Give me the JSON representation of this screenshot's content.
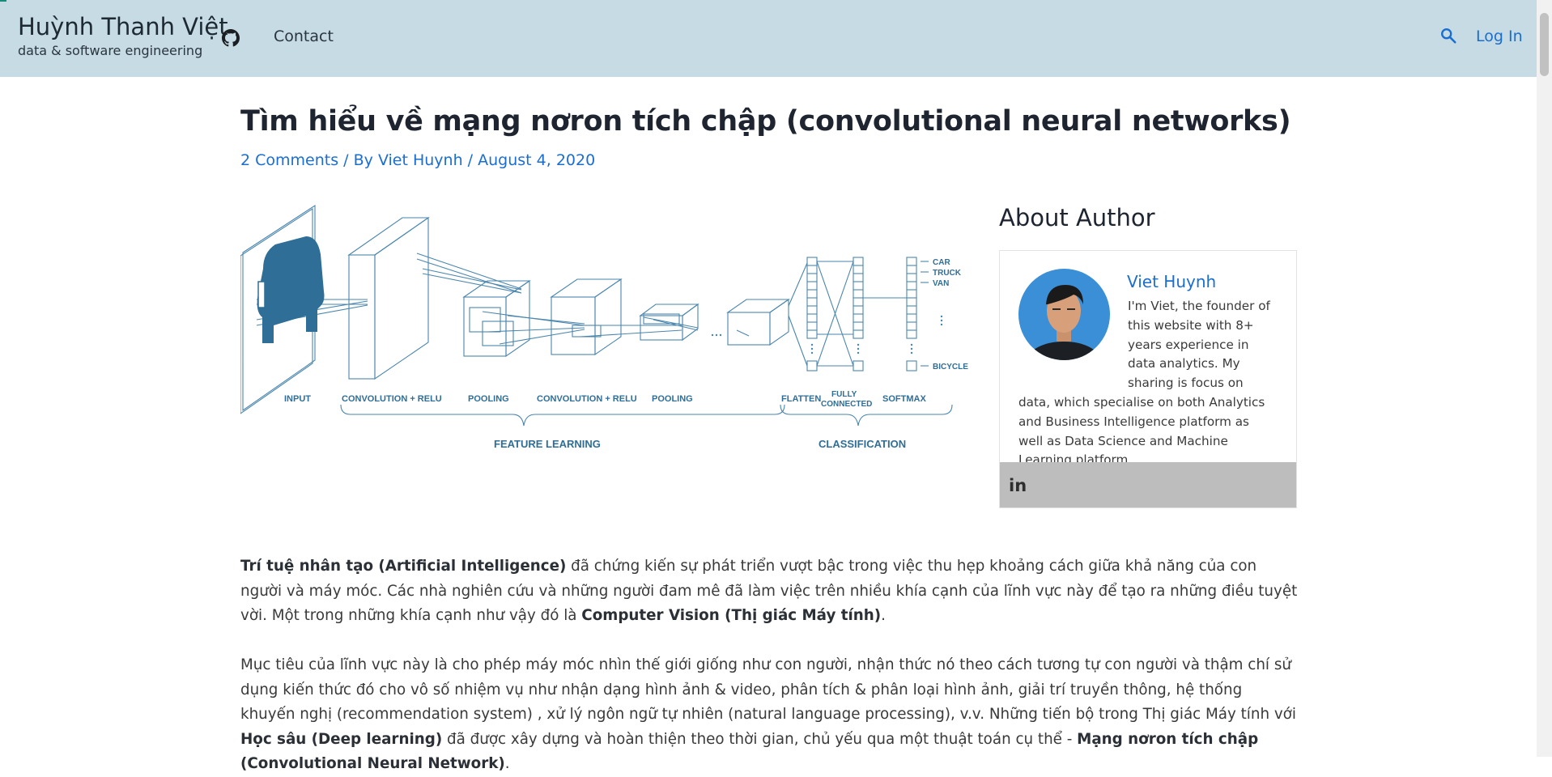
{
  "header": {
    "site_title": "Huỳnh Thanh Việt",
    "tagline": "data & software engineering",
    "nav_contact": "Contact",
    "login": "Log In",
    "icons": [
      "github-icon",
      "search-icon"
    ]
  },
  "article": {
    "title": "Tìm hiểu về mạng nơron tích chập (convolutional neural networks)",
    "meta": {
      "comments": "2 Comments",
      "sep1": " / By ",
      "author": "Viet Huynh",
      "sep2": " / ",
      "date": "August 4, 2020"
    },
    "figure": {
      "stage_labels": [
        "INPUT",
        "CONVOLUTION + RELU",
        "POOLING",
        "CONVOLUTION + RELU",
        "POOLING",
        "FLATTEN",
        "FULLY",
        "CONNECTED",
        "SOFTMAX"
      ],
      "group_labels": [
        "FEATURE LEARNING",
        "CLASSIFICATION"
      ],
      "class_labels": [
        "CAR",
        "TRUCK",
        "VAN",
        "BICYCLE"
      ],
      "colors": {
        "line": "#4a86ad",
        "fill": "#2f6e96"
      }
    },
    "p1": {
      "b1": "Trí tuệ nhân tạo (Artificial Intelligence)",
      "t1": " đã chứng kiến sự phát triển vượt bậc trong việc thu hẹp khoảng cách giữa khả năng của con người và máy móc. Các nhà nghiên cứu và những người đam mê đã làm việc trên nhiều khía cạnh của lĩnh vực này để tạo ra những điều tuyệt vời. Một trong những khía cạnh như vậy đó là ",
      "b2": "Computer Vision (Thị giác Máy tính)",
      "t2": "."
    },
    "p2": {
      "t1": "Mục tiêu của lĩnh vực này là cho phép máy móc nhìn thế giới giống như con người, nhận thức nó theo cách tương tự con người và thậm chí sử dụng kiến thức đó cho vô số nhiệm vụ như nhận dạng hình ảnh & video, phân tích & phân loại hình ảnh, giải trí truyền thông, hệ thống khuyến nghị (recommendation system) , xử lý ngôn ngữ tự nhiên (natural language processing), v.v. Những tiến bộ trong Thị giác Máy tính với ",
      "b1": "Học sâu (Deep learning)",
      "t2": " đã được xây dựng và hoàn thiện theo thời gian, chủ yếu qua một thuật toán cụ thể -  ",
      "b2": "Mạng nơron tích chập (Convolutional Neural Network)",
      "t3": "."
    }
  },
  "sidebar": {
    "widget_title": "About Author",
    "author_name": "Viet Huynh",
    "bio": "I'm Viet, the founder of this website with 8+ years experience in data analytics. My sharing is focus on data, which specialise on both Analytics and Business Intelligence platform as well as Data Science and Machine Learning platform.",
    "social_icon": "in"
  },
  "colors": {
    "header_bg": "#c6dbe3",
    "link": "#1b6ed1",
    "text": "#3a3a3a",
    "social_bar": "#bdbdbd"
  }
}
